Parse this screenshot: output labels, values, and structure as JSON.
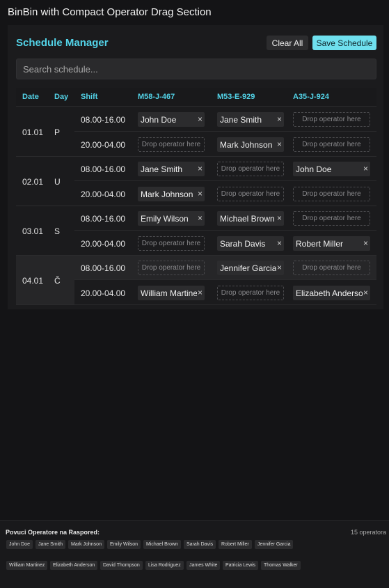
{
  "app": {
    "title": "BinBin with Compact Operator Drag Section"
  },
  "header": {
    "title": "Schedule Manager",
    "clear_label": "Clear All",
    "save_label": "Save Schedule"
  },
  "search": {
    "placeholder": "Search schedule...",
    "value": ""
  },
  "columns": [
    "Date",
    "Day",
    "Shift",
    "M58-J-467",
    "M53-E-929",
    "A35-J-924"
  ],
  "drop_text": "Drop operator here",
  "remove_glyph": "×",
  "days": [
    {
      "date": "01.01",
      "day": "P",
      "shifts": [
        {
          "shift": "08.00-16.00",
          "slots": [
            "John Doe",
            "Jane Smith",
            ""
          ]
        },
        {
          "shift": "20.00-04.00",
          "slots": [
            "",
            "Mark Johnson",
            ""
          ]
        }
      ]
    },
    {
      "date": "02.01",
      "day": "U",
      "shifts": [
        {
          "shift": "08.00-16.00",
          "slots": [
            "Jane Smith",
            "",
            "John Doe"
          ]
        },
        {
          "shift": "20.00-04.00",
          "slots": [
            "Mark Johnson",
            "",
            ""
          ]
        }
      ]
    },
    {
      "date": "03.01",
      "day": "S",
      "shifts": [
        {
          "shift": "08.00-16.00",
          "slots": [
            "Emily Wilson",
            "Michael Brown",
            ""
          ]
        },
        {
          "shift": "20.00-04.00",
          "slots": [
            "",
            "Sarah Davis",
            "Robert Miller"
          ]
        }
      ]
    },
    {
      "date": "04.01",
      "day": "Č",
      "shifts": [
        {
          "shift": "08.00-16.00",
          "slots": [
            "",
            "Jennifer Garcia",
            ""
          ]
        },
        {
          "shift": "20.00-04.00",
          "slots": [
            "William Martinez",
            "",
            "Elizabeth Anderson"
          ]
        }
      ]
    }
  ],
  "pool": {
    "title": "Povuci Operatore na Raspored:",
    "count": "15 operatora",
    "operators": [
      "John Doe",
      "Jane Smith",
      "Mark Johnson",
      "Emily Wilson",
      "Michael Brown",
      "Sarah Davis",
      "Robert Miller",
      "Jennifer Garcia",
      "William Martinez",
      "Elizabeth Anderson",
      "David Thompson",
      "Lisa Rodriguez",
      "James White",
      "Patricia Lewis",
      "Thomas Walker"
    ]
  },
  "colors": {
    "accent": "#53d3e8",
    "save_button": "#6fe0ee",
    "background": "#141416",
    "panel": "#1b1b1d",
    "highlight_group": "#262628"
  }
}
